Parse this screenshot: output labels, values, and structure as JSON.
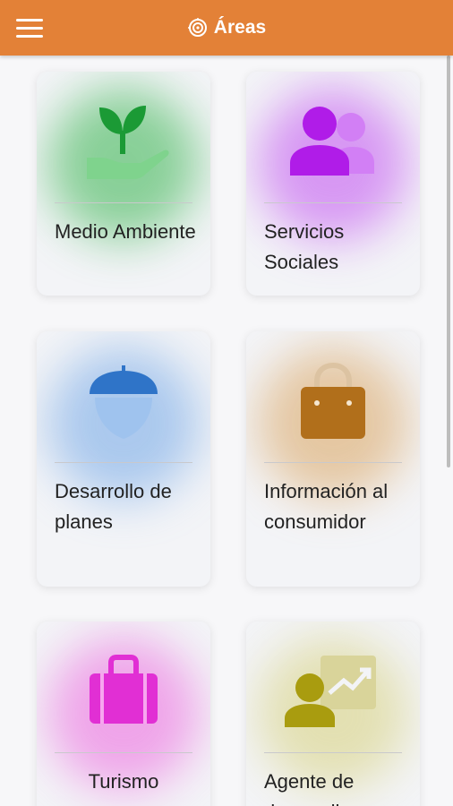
{
  "app_bar": {
    "title": "Áreas",
    "menu_icon": "hamburger-menu-icon",
    "title_icon": "target-icon",
    "color": "#e38137"
  },
  "areas": [
    {
      "label": "Medio Ambiente",
      "icon": "plant-hand-icon",
      "color": "#32b24a"
    },
    {
      "label": "Servicios Sociales",
      "icon": "people-icon",
      "color": "#b31ce6"
    },
    {
      "label": "Desarrollo de planes",
      "icon": "acorn-icon",
      "color": "#3b7dce"
    },
    {
      "label": "Información al consumidor",
      "icon": "shopping-bag-icon",
      "color": "#b4701a"
    },
    {
      "label": "Turismo",
      "icon": "suitcase-icon",
      "color": "#e633d6"
    },
    {
      "label": "Agente de desarrollo",
      "icon": "presentation-icon",
      "color": "#b0a61f"
    }
  ]
}
